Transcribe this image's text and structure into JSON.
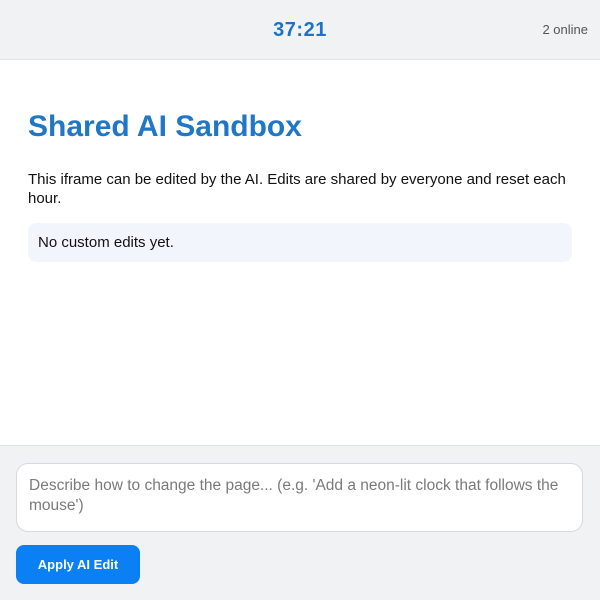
{
  "header": {
    "timer": "37:21",
    "online_status": "2 online"
  },
  "sandbox": {
    "title": "Shared AI Sandbox",
    "description": "This iframe can be edited by the AI. Edits are shared by everyone and reset each hour.",
    "edits_status": "No custom edits yet."
  },
  "composer": {
    "placeholder": "Describe how to change the page... (e.g. 'Add a neon-lit clock that follows the mouse')",
    "value": "",
    "apply_label": "Apply AI Edit"
  },
  "colors": {
    "accent": "#1a73c9",
    "button": "#0b80f5",
    "edits_box_bg": "#f2f6fc",
    "chrome_bg": "#f1f2f4"
  }
}
